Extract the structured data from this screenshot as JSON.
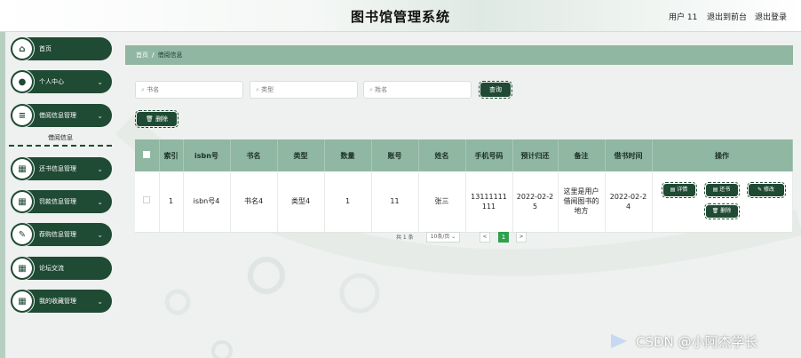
{
  "header": {
    "title": "图书馆管理系统",
    "user": "用户 11",
    "back_to_front": "退出到前台",
    "logout": "退出登录"
  },
  "sidebar": {
    "items": [
      {
        "label": "首页",
        "icon": "home-icon",
        "glyph": "⌂",
        "chevron": false
      },
      {
        "label": "个人中心",
        "icon": "user-icon",
        "glyph": "●",
        "chevron": true
      },
      {
        "label": "借阅信息管理",
        "icon": "list-icon",
        "glyph": "≡",
        "chevron": true
      },
      {
        "label": "还书信息管理",
        "icon": "grid-icon",
        "glyph": "▦",
        "chevron": true
      },
      {
        "label": "罚款信息管理",
        "icon": "grid-icon",
        "glyph": "▦",
        "chevron": true
      },
      {
        "label": "荐购信息管理",
        "icon": "tag-icon",
        "glyph": "✎",
        "chevron": true
      },
      {
        "label": "论坛交流",
        "icon": "grid-icon",
        "glyph": "▦",
        "chevron": false
      },
      {
        "label": "我的收藏管理",
        "icon": "grid-icon",
        "glyph": "▦",
        "chevron": true
      }
    ],
    "submenu": {
      "label": "借阅信息"
    }
  },
  "breadcrumb": {
    "home": "首页",
    "separator": "/",
    "current": "借阅信息"
  },
  "search": {
    "book_name_placeholder": "书名",
    "type_placeholder": "类型",
    "name_placeholder": "姓名",
    "search_button": "查询"
  },
  "actions": {
    "delete_button": "删除"
  },
  "table": {
    "headers": [
      "索引",
      "isbn号",
      "书名",
      "类型",
      "数量",
      "账号",
      "姓名",
      "手机号码",
      "预计归还",
      "备注",
      "借书时间",
      "操作"
    ],
    "rows": [
      {
        "index": "1",
        "isbn": "isbn号4",
        "book": "书名4",
        "type": "类型4",
        "qty": "1",
        "account": "11",
        "name": "张三",
        "phone": "13111111111",
        "due": "2022-02-25",
        "remark": "这里是用户借阅图书的地方",
        "borrow_time": "2022-02-24",
        "ops": {
          "detail": "详情",
          "return": "还书",
          "edit": "修改",
          "delete": "删除"
        }
      }
    ]
  },
  "pagination": {
    "total": "共 1 条",
    "page_size": "10条/页",
    "prev": "<",
    "current": "1",
    "next": ">"
  },
  "watermark": "CSDN @小阿杰学长",
  "colors": {
    "primary": "#1f4a34",
    "header_band": "#8fb7a2",
    "pager_active": "#2da14b"
  }
}
